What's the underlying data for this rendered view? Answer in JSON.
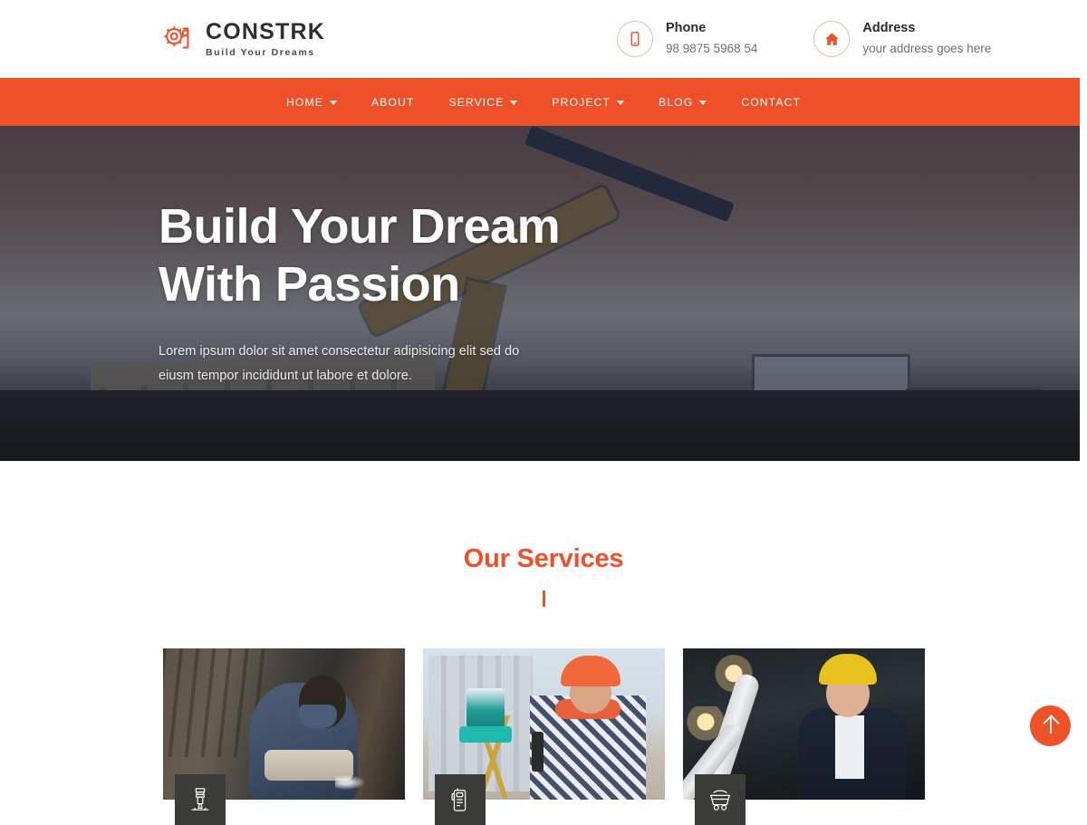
{
  "brand": {
    "name": "CONSTRK",
    "tagline": "Build Your Dreams",
    "logo_icon": "gear-wrench-icon",
    "accent_color": "#ee5129"
  },
  "header": {
    "contacts": [
      {
        "icon": "mobile-phone-icon",
        "label": "Phone",
        "value": "98 9875 5968 54"
      },
      {
        "icon": "home-icon",
        "label": "Address",
        "value": "your address goes here"
      }
    ]
  },
  "nav": {
    "items": [
      {
        "label": "HOME",
        "has_dropdown": true
      },
      {
        "label": "ABOUT",
        "has_dropdown": false
      },
      {
        "label": "SERVICE",
        "has_dropdown": true
      },
      {
        "label": "PROJECT",
        "has_dropdown": true
      },
      {
        "label": "BLOG",
        "has_dropdown": true
      },
      {
        "label": "CONTACT",
        "has_dropdown": false
      }
    ]
  },
  "hero": {
    "title_line1": "Build Your Dream",
    "title_line2": "With Passion",
    "subtitle": "Lorem ipsum dolor sit amet consectetur adipisicing elit sed do eiusm tempor incididunt ut labore et dolore.",
    "prev_icon": "chevron-left-icon",
    "next_icon": "chevron-right-icon",
    "scene_description": "excavator and dump truck on construction site at dusk"
  },
  "services": {
    "title": "Our Services",
    "cards": [
      {
        "badge_icon": "jackhammer-icon",
        "image_alt": "worker grinding metal with protective mask"
      },
      {
        "badge_icon": "walkie-talkie-icon",
        "image_alt": "surveyor in orange hard hat holding radio next to theodolite"
      },
      {
        "badge_icon": "mine-cart-icon",
        "image_alt": "architect in yellow hard hat holding rolled blueprints"
      }
    ]
  },
  "scroll_top": {
    "icon": "arrow-up-icon"
  }
}
